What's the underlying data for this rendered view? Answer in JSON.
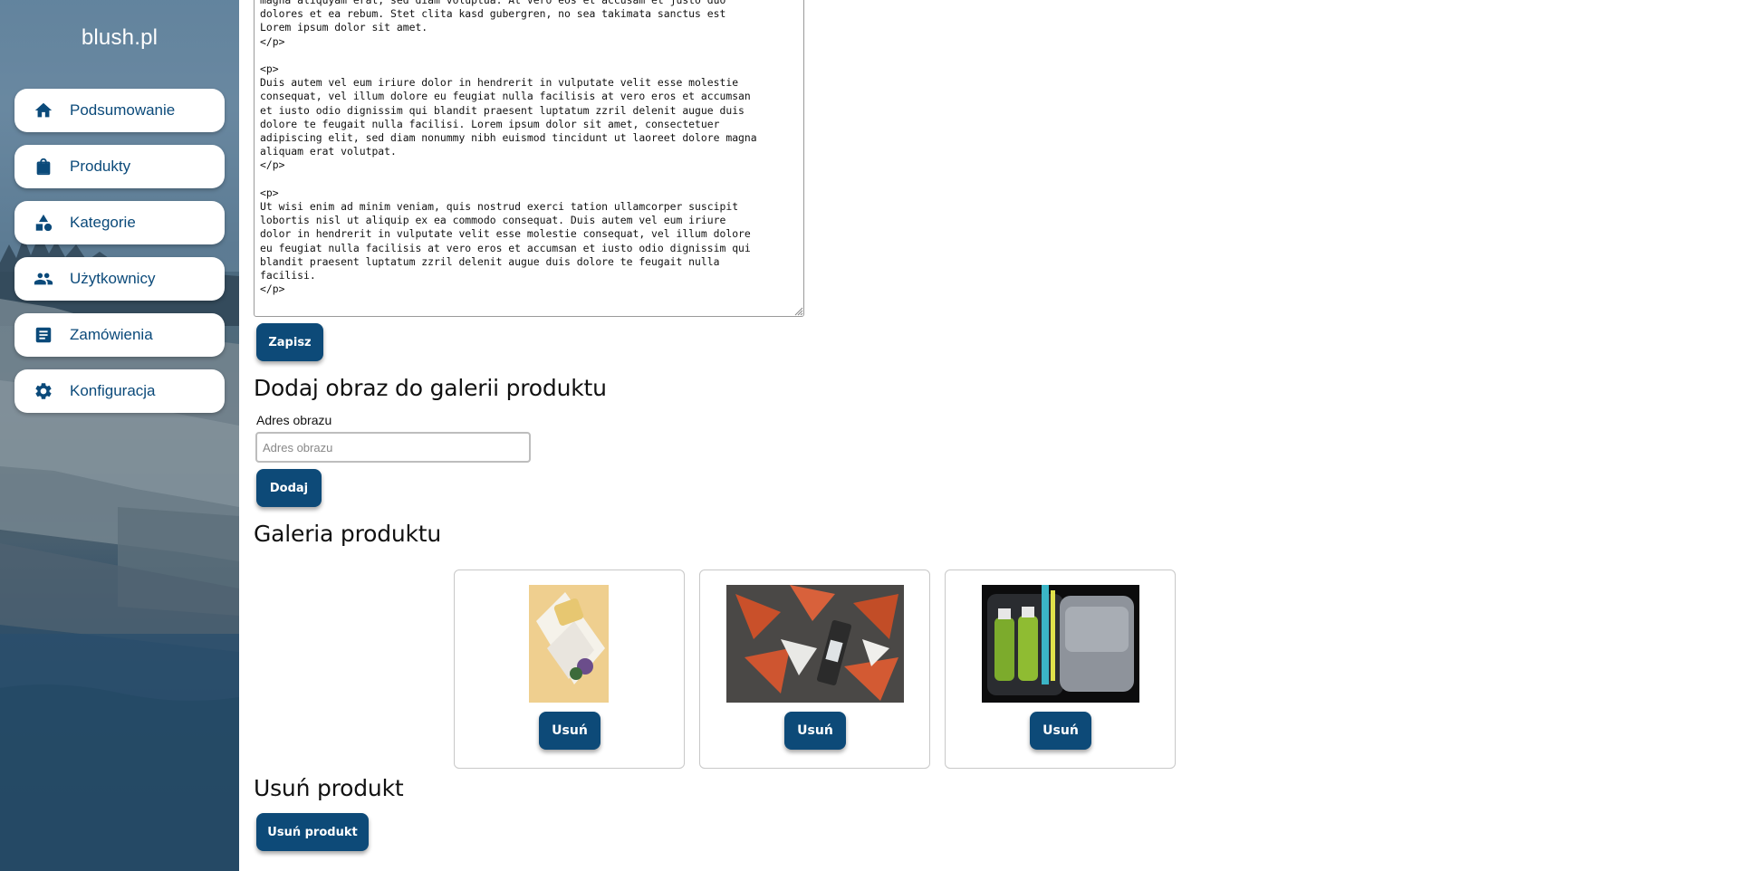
{
  "sidebar": {
    "brand": "blush.pl",
    "items": [
      {
        "label": "Podsumowanie",
        "icon": "home-icon"
      },
      {
        "label": "Produkty",
        "icon": "shopping-bag-icon"
      },
      {
        "label": "Kategorie",
        "icon": "shapes-icon"
      },
      {
        "label": "Użytkownicy",
        "icon": "people-icon"
      },
      {
        "label": "Zamówienia",
        "icon": "list-document-icon"
      },
      {
        "label": "Konfiguracja",
        "icon": "gear-icon"
      }
    ]
  },
  "editor": {
    "content": "magna aliquyam erat, sed diam voluptua. At vero eos et accusam et justo duo\ndolores et ea rebum. Stet clita kasd gubergren, no sea takimata sanctus est\nLorem ipsum dolor sit amet.\n</p>\n\n<p>\nDuis autem vel eum iriure dolor in hendrerit in vulputate velit esse molestie\nconsequat, vel illum dolore eu feugiat nulla facilisis at vero eros et accumsan\net iusto odio dignissim qui blandit praesent luptatum zzril delenit augue duis\ndolore te feugait nulla facilisi. Lorem ipsum dolor sit amet, consectetuer\nadipiscing elit, sed diam nonummy nibh euismod tincidunt ut laoreet dolore magna\naliquam erat volutpat.\n</p>\n\n<p>\nUt wisi enim ad minim veniam, quis nostrud exerci tation ullamcorper suscipit\nlobortis nisl ut aliquip ex ea commodo consequat. Duis autem vel eum iriure\ndolor in hendrerit in vulputate velit esse molestie consequat, vel illum dolore\neu feugiat nulla facilisis at vero eros et accumsan et iusto odio dignissim qui\nblandit praesent luptatum zzril delenit augue duis dolore te feugait nulla\nfacilisi.\n</p>",
    "save_label": "Zapisz"
  },
  "add_image": {
    "heading": "Dodaj obraz do galerii produktu",
    "field_label": "Adres obrazu",
    "placeholder": "Adres obrazu",
    "add_label": "Dodaj"
  },
  "gallery": {
    "heading": "Galeria produktu",
    "items": [
      {
        "image": "bottle-on-towel-photo",
        "remove_label": "Usuń"
      },
      {
        "image": "bottle-on-orange-tiles-photo",
        "remove_label": "Usuń"
      },
      {
        "image": "toiletry-bag-photo",
        "remove_label": "Usuń"
      }
    ]
  },
  "delete_product": {
    "heading": "Usuń produkt",
    "button_label": "Usuń produkt"
  },
  "colors": {
    "accent": "#0d4a78",
    "nav_text": "#0b4a7a"
  }
}
